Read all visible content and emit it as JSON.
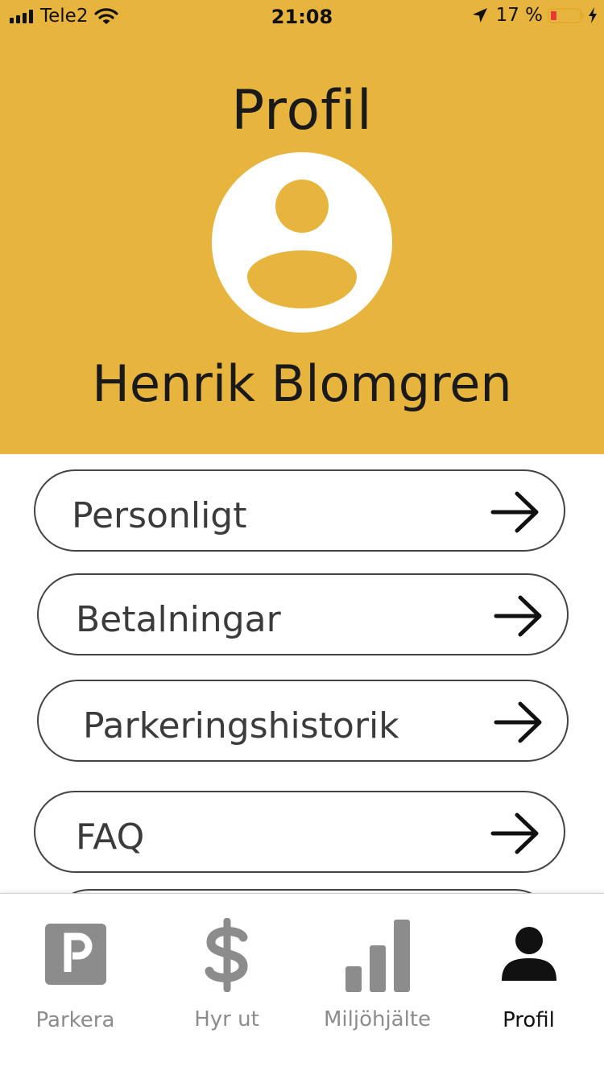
{
  "status_bar": {
    "carrier": "Tele2",
    "time": "21:08",
    "battery": "17 %"
  },
  "header": {
    "title": "Profil",
    "user_name": "Henrik Blomgren"
  },
  "menu": {
    "items": [
      {
        "label": "Personligt"
      },
      {
        "label": "Betalningar"
      },
      {
        "label": "Parkeringshistorik"
      },
      {
        "label": "FAQ"
      }
    ]
  },
  "tab_bar": {
    "tabs": [
      {
        "label": "Parkera",
        "icon": "parking-icon"
      },
      {
        "label": "Hyr ut",
        "icon": "dollar-icon"
      },
      {
        "label": "Miljöhjälte",
        "icon": "bar-chart-icon"
      },
      {
        "label": "Profil",
        "icon": "user-icon",
        "active": true
      }
    ]
  },
  "colors": {
    "header_bg": "#e7b43e",
    "battery_low": "#e6393a",
    "tab_inactive": "#8c8c8c",
    "tab_active": "#111111"
  }
}
